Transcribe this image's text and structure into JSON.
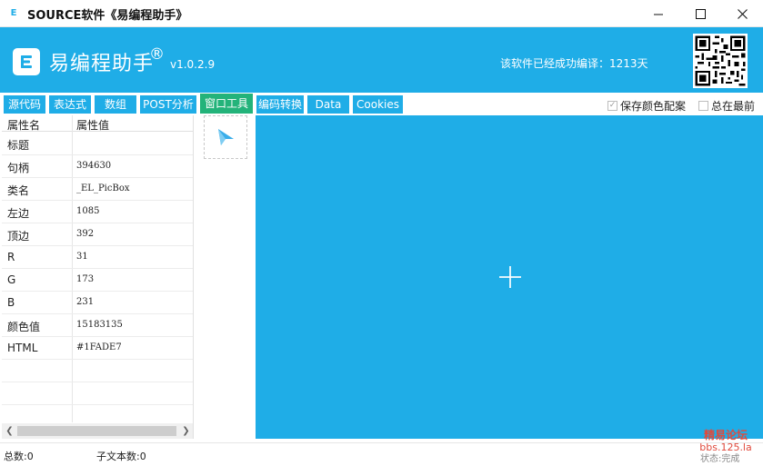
{
  "window": {
    "title": "SOURCE软件《易编程助手》",
    "icon_letter": "E"
  },
  "header": {
    "logo_letter": "E",
    "brand_name": "易编程助手",
    "brand_reg": "®",
    "version": "v1.0.2.9",
    "compile_stat": "该软件已经成功编译：1213天"
  },
  "tabs": [
    {
      "label": "源代码"
    },
    {
      "label": "表达式"
    },
    {
      "label": "数组"
    },
    {
      "label": "POST分析"
    },
    {
      "label": "窗口工具"
    },
    {
      "label": "编码转换"
    },
    {
      "label": "Data"
    },
    {
      "label": "Cookies"
    }
  ],
  "active_tab": "窗口工具",
  "options": {
    "save_color": {
      "label": "保存颜色配案",
      "checked": true
    },
    "always_top": {
      "label": "总在最前",
      "checked": false
    }
  },
  "property_grid": {
    "header": {
      "name": "属性名",
      "value": "属性值"
    },
    "rows": [
      {
        "name": "标题",
        "value": ""
      },
      {
        "name": "句柄",
        "value": "394630"
      },
      {
        "name": "类名",
        "value": "_EL_PicBox"
      },
      {
        "name": "左边",
        "value": "1085"
      },
      {
        "name": "顶边",
        "value": "392"
      },
      {
        "name": "R",
        "value": "31"
      },
      {
        "name": "G",
        "value": "173"
      },
      {
        "name": "B",
        "value": "231"
      },
      {
        "name": "颜色值",
        "value": "15183135"
      },
      {
        "name": "HTML",
        "value": "#1FADE7"
      }
    ]
  },
  "preview_color": "#1FADE7",
  "status": {
    "total": "总数:0",
    "sub_text": "子文本数:0",
    "right": "状态:完成"
  },
  "watermark": {
    "name": "精易论坛",
    "url": "bbs.125.la"
  },
  "colors": {
    "accent": "#1fade7",
    "active_tab": "#23b37a",
    "watermark": "#e04a3c"
  },
  "icons": {
    "app": "e-logo-icon",
    "minimize": "minimize-icon",
    "maximize": "maximize-icon",
    "close": "close-icon",
    "finder": "pointer-arrow-icon",
    "crosshair": "crosshair-icon",
    "qr": "qr-code-icon"
  }
}
